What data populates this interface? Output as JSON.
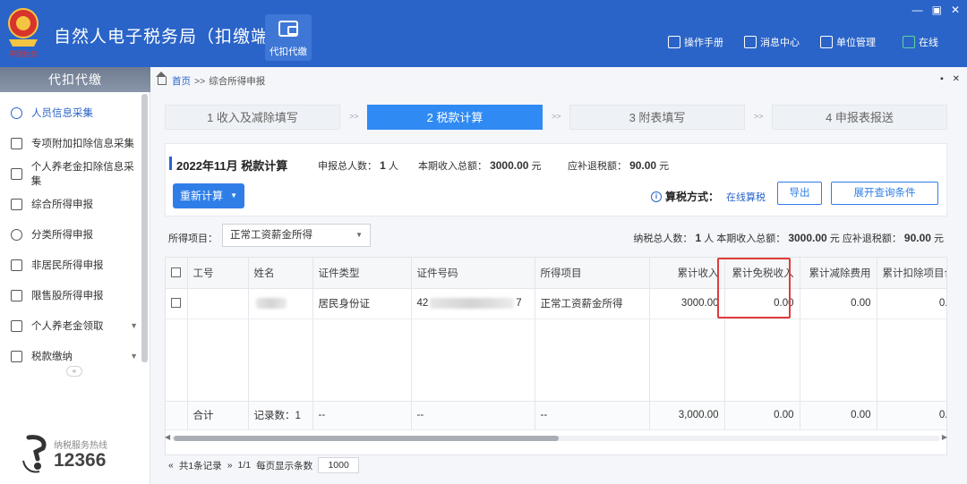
{
  "header": {
    "title": "自然人电子税务局（扣缴端）",
    "emblem_caption": "中国税务",
    "module_label": "代扣代缴",
    "links": [
      {
        "label": "操作手册",
        "icon": "manual-icon"
      },
      {
        "label": "消息中心",
        "icon": "message-icon"
      },
      {
        "label": "单位管理",
        "icon": "unit-icon"
      },
      {
        "label": "在线",
        "icon": "online-status-icon"
      }
    ]
  },
  "sidebar": {
    "title": "代扣代缴",
    "items": [
      {
        "label": "人员信息采集",
        "icon": "person-icon",
        "active": true
      },
      {
        "label": "专项附加扣除信息采集",
        "icon": "list-icon"
      },
      {
        "label": "个人养老金扣除信息采集",
        "icon": "pension-icon"
      },
      {
        "label": "综合所得申报",
        "icon": "layers-icon"
      },
      {
        "label": "分类所得申报",
        "icon": "pie-icon"
      },
      {
        "label": "非居民所得申报",
        "icon": "foreign-person-icon"
      },
      {
        "label": "限售股所得申报",
        "icon": "bar-chart-icon"
      },
      {
        "label": "个人养老金领取",
        "icon": "pension-icon",
        "expandable": true
      },
      {
        "label": "税款缴纳",
        "icon": "card-icon",
        "expandable": true
      }
    ],
    "collapse_symbol": "«",
    "hotline_label": "纳税服务热线",
    "hotline_number": "12366"
  },
  "breadcrumb": {
    "home": "首页",
    "separator": ">>",
    "current": "综合所得申报"
  },
  "steps": [
    {
      "label": "1 收入及减除填写"
    },
    {
      "label": "2 税款计算",
      "active": true
    },
    {
      "label": "3 附表填写"
    },
    {
      "label": "4 申报表报送"
    }
  ],
  "step_separator": ">>",
  "panel": {
    "title": "2022年11月  税款计算",
    "declarants_label": "申报总人数：",
    "declarants_value": "1",
    "declarants_unit": "人",
    "income_label": "本期收入总额：",
    "income_value": "3000.00",
    "income_unit": "元",
    "refund_label": "应补退税额：",
    "refund_value": "90.00",
    "refund_unit": "元",
    "recalc_label": "重新计算",
    "calc_mode_label": "算税方式：",
    "calc_mode_value": "在线算税",
    "export_label": "导出",
    "expand_query_label": "展开查询条件"
  },
  "filter": {
    "income_item_label": "所得项目：",
    "income_item_value": "正常工资薪金所得",
    "taxpayers_label": "纳税总人数：",
    "taxpayers_value": "1",
    "taxpayers_unit": "人",
    "income_label": "本期收入总额：",
    "income_value": "3000.00",
    "income_unit": "元",
    "refund_label": "应补退税额：",
    "refund_value": "90.00",
    "refund_unit": "元"
  },
  "table": {
    "columns": [
      "工号",
      "姓名",
      "证件类型",
      "证件号码",
      "所得项目",
      "累计收入",
      "累计免税收入",
      "累计减除费用",
      "累计扣除项目合"
    ],
    "rows": [
      {
        "id_type": "居民身份证",
        "id_prefix": "42",
        "id_suffix": "7",
        "income_item": "正常工资薪金所得",
        "cum_income": "3000.00",
        "cum_exempt": "0.00",
        "cum_deduction": "0.00",
        "cum_items": "0."
      }
    ],
    "total": {
      "label": "合计",
      "record_count": "记录数：1",
      "id_type": "--",
      "id_no": "--",
      "income_item": "--",
      "cum_income": "3,000.00",
      "cum_exempt": "0.00",
      "cum_deduction": "0.00",
      "cum_items": "0."
    }
  },
  "pager": {
    "records": "共1条记录",
    "pages": "1/1",
    "page_size_label": "每页显示条数",
    "page_size": "1000"
  },
  "colors": {
    "header_bg": "#2a64c8",
    "accent": "#2f8af3",
    "highlight": "#e23b3b"
  }
}
